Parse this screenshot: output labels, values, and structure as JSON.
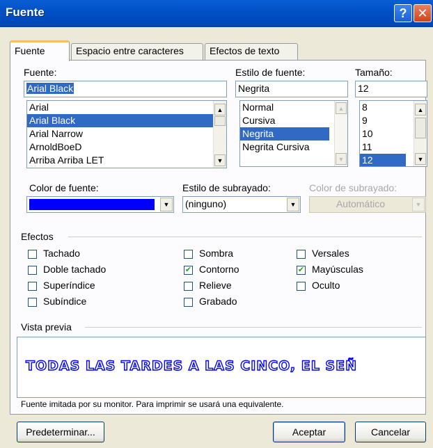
{
  "window": {
    "title": "Fuente",
    "help_glyph": "?",
    "close_glyph": "✕"
  },
  "tabs": [
    {
      "label": "Fuente",
      "active": true
    },
    {
      "label": "Espacio entre caracteres",
      "active": false
    },
    {
      "label": "Efectos de texto",
      "active": false
    }
  ],
  "font": {
    "label": "Fuente:",
    "value": "Arial Black",
    "items": [
      "Arial",
      "Arial Black",
      "Arial Narrow",
      "ArnoldBoeD",
      "Arriba Arriba LET"
    ],
    "selected_index": 1
  },
  "style": {
    "label": "Estilo de fuente:",
    "value": "Negrita",
    "items": [
      "Normal",
      "Cursiva",
      "Negrita",
      "Negrita Cursiva"
    ],
    "selected_index": 2
  },
  "size": {
    "label": "Tamaño:",
    "value": "12",
    "items": [
      "8",
      "9",
      "10",
      "11",
      "12"
    ],
    "selected_index": 4
  },
  "font_color": {
    "label": "Color de fuente:",
    "color": "#0000ff"
  },
  "underline_style": {
    "label": "Estilo de subrayado:",
    "value": "(ninguno)"
  },
  "underline_color": {
    "label": "Color de subrayado:",
    "value": "Automático",
    "enabled": false
  },
  "effects": {
    "label": "Efectos",
    "items": [
      {
        "label": "Tachado",
        "checked": false
      },
      {
        "label": "Doble tachado",
        "checked": false
      },
      {
        "label": "Superíndice",
        "checked": false
      },
      {
        "label": "Subíndice",
        "checked": false
      },
      {
        "label": "Sombra",
        "checked": false
      },
      {
        "label": "Contorno",
        "checked": true
      },
      {
        "label": "Relieve",
        "checked": false
      },
      {
        "label": "Grabado",
        "checked": false
      },
      {
        "label": "Versales",
        "checked": false
      },
      {
        "label": "Mayúsculas",
        "checked": true
      },
      {
        "label": "Oculto",
        "checked": false
      }
    ]
  },
  "preview": {
    "label": "Vista previa",
    "text": "TODAS LAS TARDES A LAS CINCO, EL SEÑ",
    "note": "Fuente imitada por su monitor. Para imprimir se usará una equivalente."
  },
  "buttons": {
    "default_label": "Predeterminar...",
    "ok_label": "Aceptar",
    "cancel_label": "Cancelar"
  },
  "colors": {
    "titlebar": "#0050c8",
    "selection": "#316ac5",
    "dialog_bg": "#ece9d8"
  }
}
